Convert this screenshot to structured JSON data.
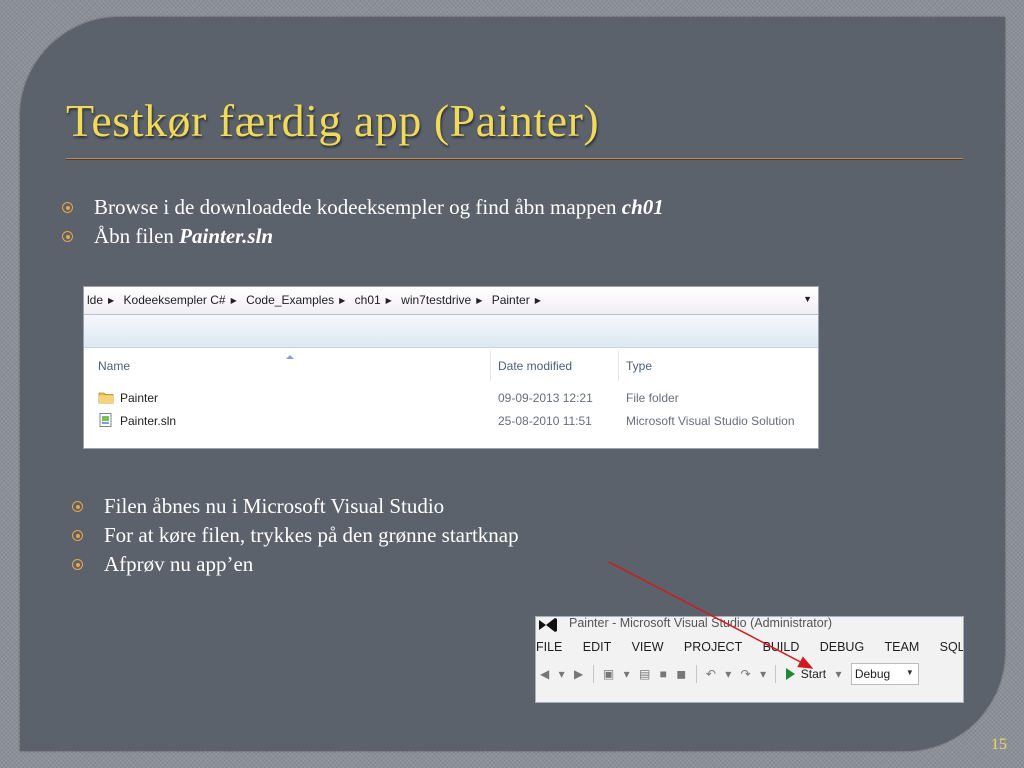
{
  "slide": {
    "title": "Testkør færdig app (Painter)",
    "page_number": "15"
  },
  "bullets_top": [
    {
      "text": "Browse i de downloadede kodeeksempler og find åbn mappen ",
      "emphasis": "ch01"
    },
    {
      "text": "Åbn filen ",
      "emphasis": "Painter.sln"
    }
  ],
  "explorer": {
    "breadcrumbs": [
      "lde",
      "Kodeeksempler C#",
      "Code_Examples",
      "ch01",
      "win7testdrive",
      "Painter"
    ],
    "columns": {
      "name": "Name",
      "date": "Date modified",
      "type": "Type"
    },
    "rows": [
      {
        "name": "Painter",
        "date": "09-09-2013 12:21",
        "type": "File folder",
        "icon": "folder-icon"
      },
      {
        "name": "Painter.sln",
        "date": "25-08-2010 11:51",
        "type": "Microsoft Visual Studio Solution",
        "icon": "solution-file-icon"
      }
    ]
  },
  "bullets_bottom": [
    {
      "text": "Filen åbnes nu i Microsoft Visual Studio"
    },
    {
      "text": "For at køre filen, trykkes på den grønne startknap"
    },
    {
      "text": "Afprøv nu app’en"
    }
  ],
  "visual_studio": {
    "window_title": "Painter - Microsoft Visual Studio (Administrator)",
    "menu": [
      "FILE",
      "EDIT",
      "VIEW",
      "PROJECT",
      "BUILD",
      "DEBUG",
      "TEAM",
      "SQL"
    ],
    "start_label": "Start",
    "configuration": "Debug"
  },
  "colors": {
    "title": "#f1d95a",
    "bullet": "#e7a648",
    "slide_bg": "#5b626c",
    "annotation_arrow": "#d11a1a",
    "start_green": "#1f8a2f"
  }
}
